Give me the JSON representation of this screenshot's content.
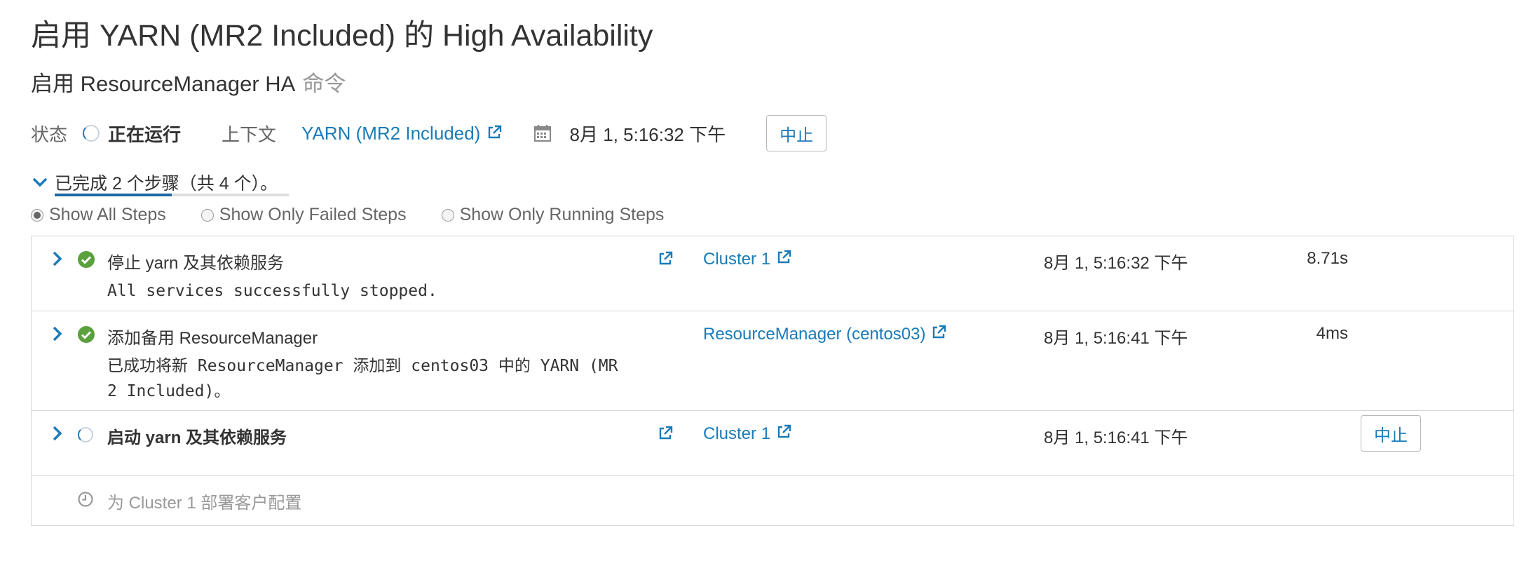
{
  "header": {
    "title": "启用 YARN (MR2 Included) 的 High Availability",
    "subtitle": "启用 ResourceManager HA",
    "subtitle_suffix": "命令"
  },
  "status": {
    "label": "状态",
    "value": "正在运行",
    "context_label": "上下文",
    "context_link": "YARN (MR2 Included)",
    "start_time": "8月 1, 5:16:32 下午",
    "abort_label": "中止"
  },
  "progress": {
    "text": "已完成 2 个步骤（共 4 个）。",
    "completed": 2,
    "total": 4
  },
  "filters": {
    "options": [
      "Show All Steps",
      "Show Only Failed Steps",
      "Show Only Running Steps"
    ],
    "selected": "Show All Steps"
  },
  "steps": [
    {
      "name": "停止 yarn 及其依赖服务",
      "status": "success",
      "message": "All services successfully stopped.",
      "context": "Cluster 1",
      "time": "8月 1, 5:16:32 下午",
      "duration": "8.71s"
    },
    {
      "name": "添加备用 ResourceManager",
      "status": "success",
      "message": "已成功将新 ResourceManager 添加到 centos03 中的 YARN (MR 2 Included)。",
      "context": "ResourceManager (centos03)",
      "time": "8月 1, 5:16:41 下午",
      "duration": "4ms"
    },
    {
      "name": "启动 yarn 及其依赖服务",
      "status": "running",
      "context": "Cluster 1",
      "time": "8月 1, 5:16:41 下午",
      "abort_label": "中止"
    },
    {
      "name": "为 Cluster 1 部署客户配置",
      "status": "pending"
    }
  ],
  "colors": {
    "link": "#1a7bb8",
    "success": "#5aa03c",
    "progress_fill": "#1a6aa0",
    "muted_text": "#999999"
  }
}
